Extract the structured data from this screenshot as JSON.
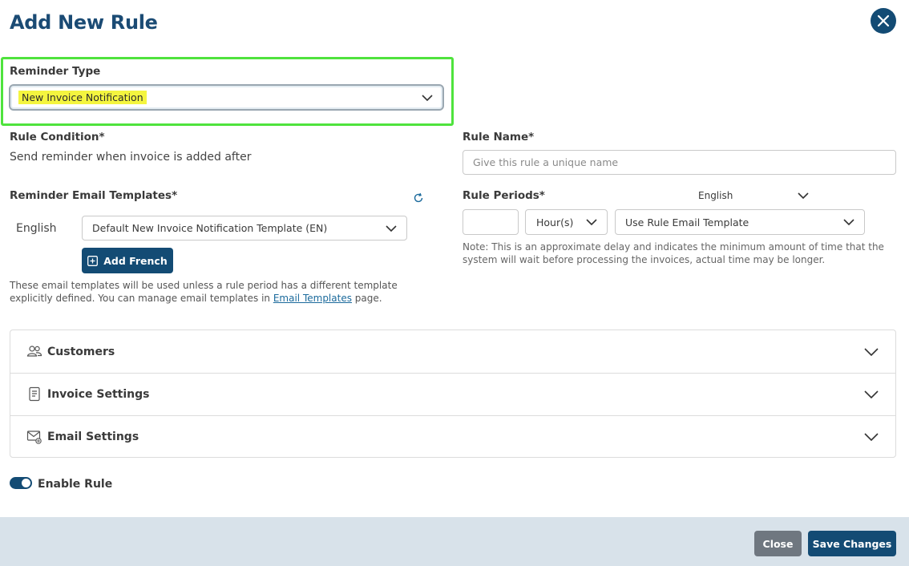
{
  "dialog": {
    "title": "Add New Rule"
  },
  "reminder_type": {
    "label": "Reminder Type",
    "value": "New Invoice Notification"
  },
  "rule_condition": {
    "label": "Rule Condition*",
    "text": "Send reminder when invoice is added after"
  },
  "rule_name": {
    "label": "Rule Name*",
    "placeholder": "Give this rule a unique name"
  },
  "email_templates": {
    "label": "Reminder Email Templates*",
    "language": "English",
    "template_value": "Default New Invoice Notification Template (EN)",
    "add_button": "Add French",
    "help_text": "These email templates will be used unless a rule period has a different template explicitly defined. You can manage email templates in",
    "help_link": "Email Templates",
    "help_suffix": "page."
  },
  "rule_periods": {
    "label": "Rule Periods*",
    "language": "English",
    "amount_value": "",
    "unit_value": "Hour(s)",
    "template_value": "Use Rule Email Template",
    "note": "Note: This is an approximate delay and indicates the minimum amount of time that the system will wait before processing the invoices, actual time may be longer."
  },
  "sections": [
    {
      "label": "Customers",
      "icon": "customers-icon"
    },
    {
      "label": "Invoice Settings",
      "icon": "invoice-icon"
    },
    {
      "label": "Email Settings",
      "icon": "email-icon"
    }
  ],
  "enable_rule": {
    "label": "Enable Rule",
    "enabled": true
  },
  "footer": {
    "close_label": "Close",
    "save_label": "Save Changes"
  },
  "colors": {
    "primary": "#134b74",
    "highlight_border": "#4fe33d",
    "highlight_text": "#f4f53f",
    "footer_bg": "#d8e2ea"
  }
}
